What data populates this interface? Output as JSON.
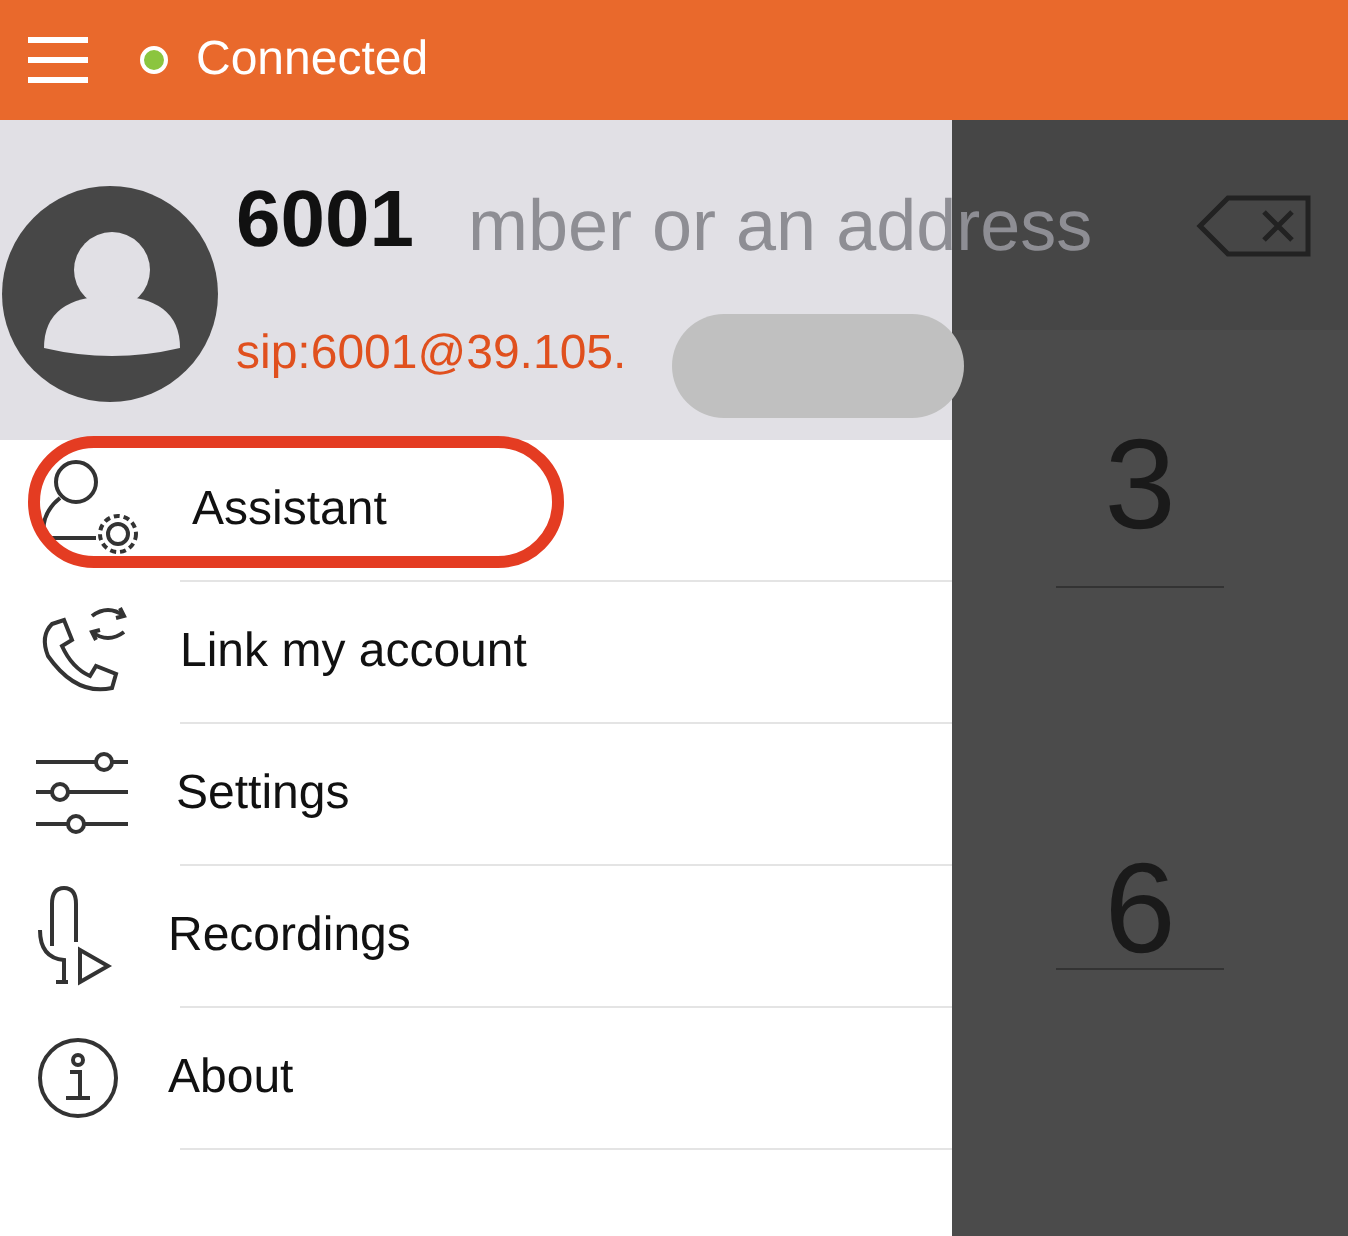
{
  "top_bar": {
    "status": "Connected",
    "connected": true
  },
  "account": {
    "name": "6001",
    "address": "sip:6001@39.105."
  },
  "menu": [
    {
      "kind": "assistant",
      "label": "Assistant",
      "highlighted": true
    },
    {
      "kind": "link",
      "label": "Link my account",
      "highlighted": false
    },
    {
      "kind": "settings",
      "label": "Settings",
      "highlighted": false
    },
    {
      "kind": "recordings",
      "label": "Recordings",
      "highlighted": false
    },
    {
      "kind": "about",
      "label": "About",
      "highlighted": false
    }
  ],
  "dialer": {
    "placeholder": "mber or an address",
    "keys": [
      "3",
      "6"
    ]
  }
}
